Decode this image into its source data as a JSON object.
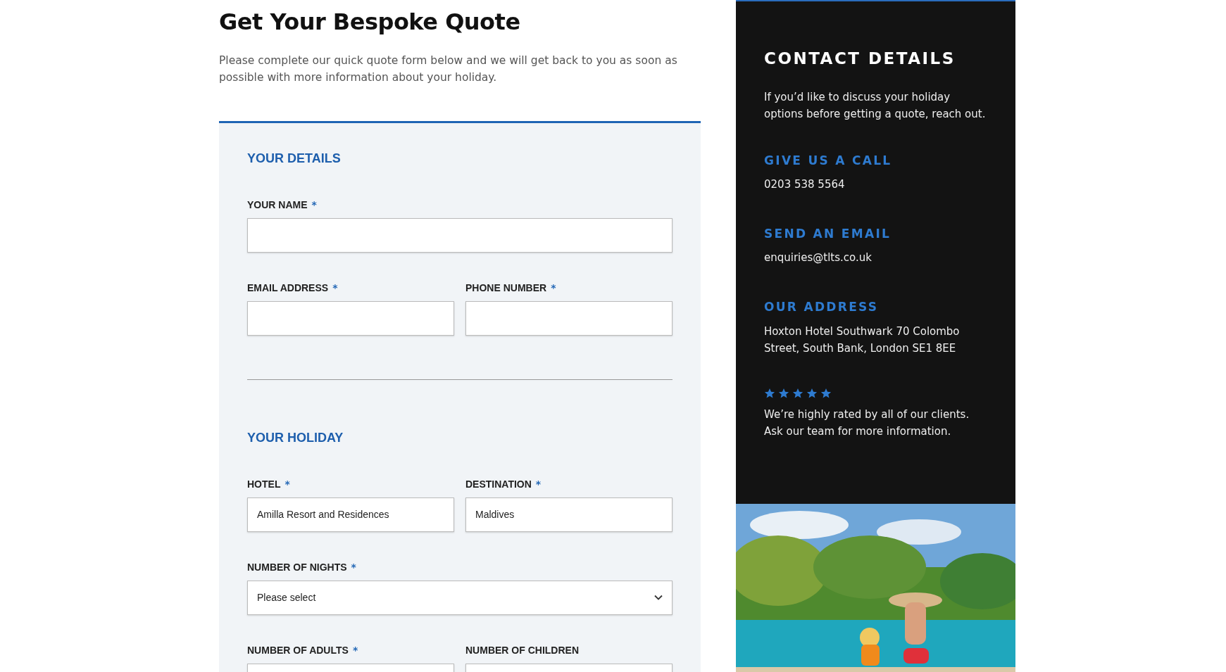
{
  "title": "Get Your Bespoke Quote",
  "intro": "Please complete our quick quote form below and we will get back to you as soon as possible with more information about your holiday.",
  "form_sections": [
    {
      "heading": "YOUR DETAILS",
      "rows": [
        [
          {
            "label": "YOUR NAME",
            "required_mark": "*",
            "kind": "text"
          }
        ],
        [
          {
            "label": "EMAIL ADDRESS",
            "required_mark": "*",
            "kind": "text"
          },
          {
            "label": "PHONE NUMBER",
            "required_mark": "*",
            "kind": "text"
          }
        ]
      ]
    },
    {
      "heading": "YOUR HOLIDAY",
      "rows": [
        [
          {
            "label": "HOTEL",
            "required_mark": "*",
            "kind": "text",
            "value": "Amilla Resort and Residences"
          },
          {
            "label": "DESTINATION",
            "required_mark": "*",
            "kind": "text",
            "value": "Maldives"
          }
        ],
        [
          {
            "label": "NUMBER OF NIGHTS",
            "required_mark": "*",
            "kind": "select",
            "value": "Please select"
          }
        ],
        [
          {
            "label": "NUMBER OF ADULTS",
            "required_mark": "*",
            "kind": "text"
          },
          {
            "label": "NUMBER OF CHILDREN",
            "kind": "text"
          }
        ]
      ]
    }
  ],
  "contact": {
    "heading": "CONTACT DETAILS",
    "intro": "If you’d like to discuss your holiday options before getting a quote, reach out.",
    "items": [
      {
        "heading": "GIVE US A CALL",
        "text": "0203 538 5564"
      },
      {
        "heading": "SEND AN EMAIL",
        "text": "enquiries@tlts.co.uk"
      },
      {
        "heading": "OUR ADDRESS",
        "text": "Hoxton Hotel Southwark 70 Colombo Street, South Bank, London SE1 8EE"
      }
    ],
    "rating": {
      "stars": 5,
      "text": "We’re highly rated by all of our clients. Ask our team for more information."
    }
  }
}
